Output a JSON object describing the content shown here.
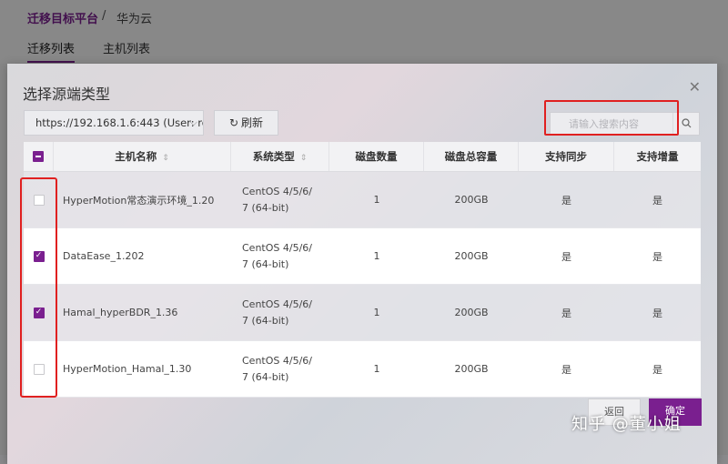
{
  "background": {
    "title": "迁移目标平台",
    "separator": "/",
    "breadcrumb": "华为云",
    "tabs": [
      {
        "label": "迁移列表",
        "active": true
      },
      {
        "label": "主机列表",
        "active": false
      }
    ]
  },
  "modal": {
    "title": "选择源端类型",
    "close_icon": "close-icon",
    "source_select_value": "https://192.168.1.6:443 (User: ro",
    "refresh_label": "刷新",
    "search_placeholder": "请输入搜索内容"
  },
  "table": {
    "columns": [
      "主机名称",
      "系统类型",
      "磁盘数量",
      "磁盘总容量",
      "支持同步",
      "支持增量"
    ],
    "header_checkbox": "partial",
    "rows": [
      {
        "checked": false,
        "name": "HyperMotion常态演示环境_1.20",
        "os_line1": "CentOS 4/5/6/",
        "os_line2": "7 (64-bit)",
        "disks": "1",
        "capacity": "200GB",
        "sync": "是",
        "incremental": "是"
      },
      {
        "checked": true,
        "name": "DataEase_1.202",
        "os_line1": "CentOS 4/5/6/",
        "os_line2": "7 (64-bit)",
        "disks": "1",
        "capacity": "200GB",
        "sync": "是",
        "incremental": "是"
      },
      {
        "checked": true,
        "name": "Hamal_hyperBDR_1.36",
        "os_line1": "CentOS 4/5/6/",
        "os_line2": "7 (64-bit)",
        "disks": "1",
        "capacity": "200GB",
        "sync": "是",
        "incremental": "是"
      },
      {
        "checked": false,
        "name": "HyperMotion_Hamal_1.30",
        "os_line1": "CentOS 4/5/6/",
        "os_line2": "7 (64-bit)",
        "disks": "1",
        "capacity": "200GB",
        "sync": "是",
        "incremental": "是"
      }
    ]
  },
  "footer": {
    "cancel_label": "返回",
    "ok_label": "确定"
  },
  "watermark": "知乎 @董小姐",
  "colors": {
    "accent": "#7a1f8f",
    "highlight": "#e02020"
  }
}
